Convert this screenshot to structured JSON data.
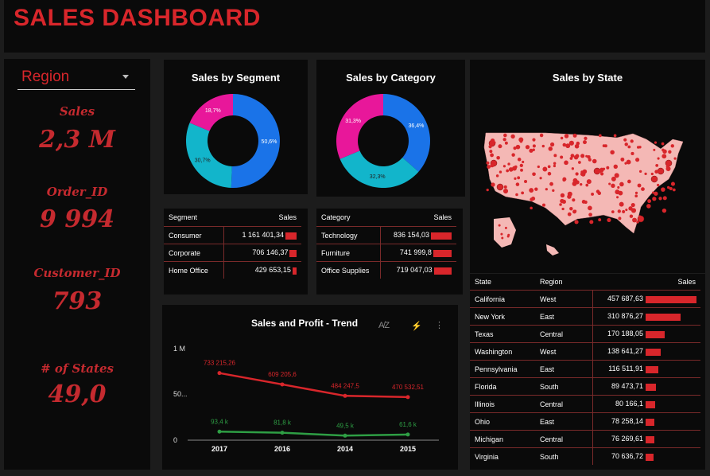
{
  "dashboard": {
    "title": "SALES DASHBOARD"
  },
  "filter": {
    "region_label": "Region"
  },
  "kpis": [
    {
      "label": "Sales",
      "value": "2,3 M"
    },
    {
      "label": "Order_ID",
      "value": "9 994"
    },
    {
      "label": "Customer_ID",
      "value": "793"
    },
    {
      "label": "# of States",
      "value": "49,0"
    }
  ],
  "segment": {
    "title": "Sales by Segment",
    "slices": [
      {
        "label": "50,6%",
        "value": 50.6,
        "color": "#1a73e8"
      },
      {
        "label": "30,7%",
        "value": 30.7,
        "color": "#12b5cb"
      },
      {
        "label": "18,7%",
        "value": 18.7,
        "color": "#e8179a"
      }
    ],
    "table": {
      "headers": [
        "Segment",
        "Sales"
      ],
      "rows": [
        {
          "name": "Consumer",
          "sales": "1 161 401,34",
          "frac": 1.0
        },
        {
          "name": "Corporate",
          "sales": "706 146,37",
          "frac": 0.61
        },
        {
          "name": "Home Office",
          "sales": "429 653,15",
          "frac": 0.37
        }
      ]
    }
  },
  "category": {
    "title": "Sales by Category",
    "slices": [
      {
        "label": "36,4%",
        "value": 36.4,
        "color": "#1a73e8"
      },
      {
        "label": "32,3%",
        "value": 32.3,
        "color": "#12b5cb"
      },
      {
        "label": "31,3%",
        "value": 31.3,
        "color": "#e8179a"
      }
    ],
    "table": {
      "headers": [
        "Category",
        "Sales"
      ],
      "rows": [
        {
          "name": "Technology",
          "sales": "836 154,03",
          "frac": 1.0
        },
        {
          "name": "Furniture",
          "sales": "741 999,8",
          "frac": 0.89
        },
        {
          "name": "Office Supplies",
          "sales": "719 047,03",
          "frac": 0.86
        }
      ]
    }
  },
  "state": {
    "title": "Sales by State",
    "table": {
      "headers": [
        "State",
        "Region",
        "Sales"
      ],
      "rows": [
        {
          "state": "California",
          "region": "West",
          "sales": "457 687,63",
          "frac": 1.0
        },
        {
          "state": "New York",
          "region": "East",
          "sales": "310 876,27",
          "frac": 0.68
        },
        {
          "state": "Texas",
          "region": "Central",
          "sales": "170 188,05",
          "frac": 0.37
        },
        {
          "state": "Washington",
          "region": "West",
          "sales": "138 641,27",
          "frac": 0.3
        },
        {
          "state": "Pennsylvania",
          "region": "East",
          "sales": "116 511,91",
          "frac": 0.25
        },
        {
          "state": "Florida",
          "region": "South",
          "sales": "89 473,71",
          "frac": 0.2
        },
        {
          "state": "Illinois",
          "region": "Central",
          "sales": "80 166,1",
          "frac": 0.18
        },
        {
          "state": "Ohio",
          "region": "East",
          "sales": "78 258,14",
          "frac": 0.17
        },
        {
          "state": "Michigan",
          "region": "Central",
          "sales": "76 269,61",
          "frac": 0.17
        },
        {
          "state": "Virginia",
          "region": "South",
          "sales": "70 636,72",
          "frac": 0.15
        }
      ]
    }
  },
  "trend": {
    "title": "Sales and Profit - Trend",
    "icons": [
      "sort-az-icon",
      "lightning-icon",
      "more-vertical-icon"
    ]
  },
  "chart_data": {
    "type": "line",
    "title": "Sales and Profit - Trend",
    "categories": [
      "2017",
      "2016",
      "2014",
      "2015"
    ],
    "y_ticks": [
      "1 M",
      "50...",
      "0"
    ],
    "ylim": [
      0,
      1000000
    ],
    "series": [
      {
        "color": "#d8262b",
        "values": [
          733215.26,
          609205.6,
          484247.5,
          470532.51
        ],
        "labels": [
          "733 215,26",
          "609 205,6",
          "484 247,5",
          "470 532,51"
        ]
      },
      {
        "color": "#2e9e44",
        "values": [
          93400,
          81800,
          49500,
          61600
        ],
        "labels": [
          "93,4 k",
          "81,8 k",
          "49,5 k",
          "61,6 k"
        ]
      }
    ]
  }
}
